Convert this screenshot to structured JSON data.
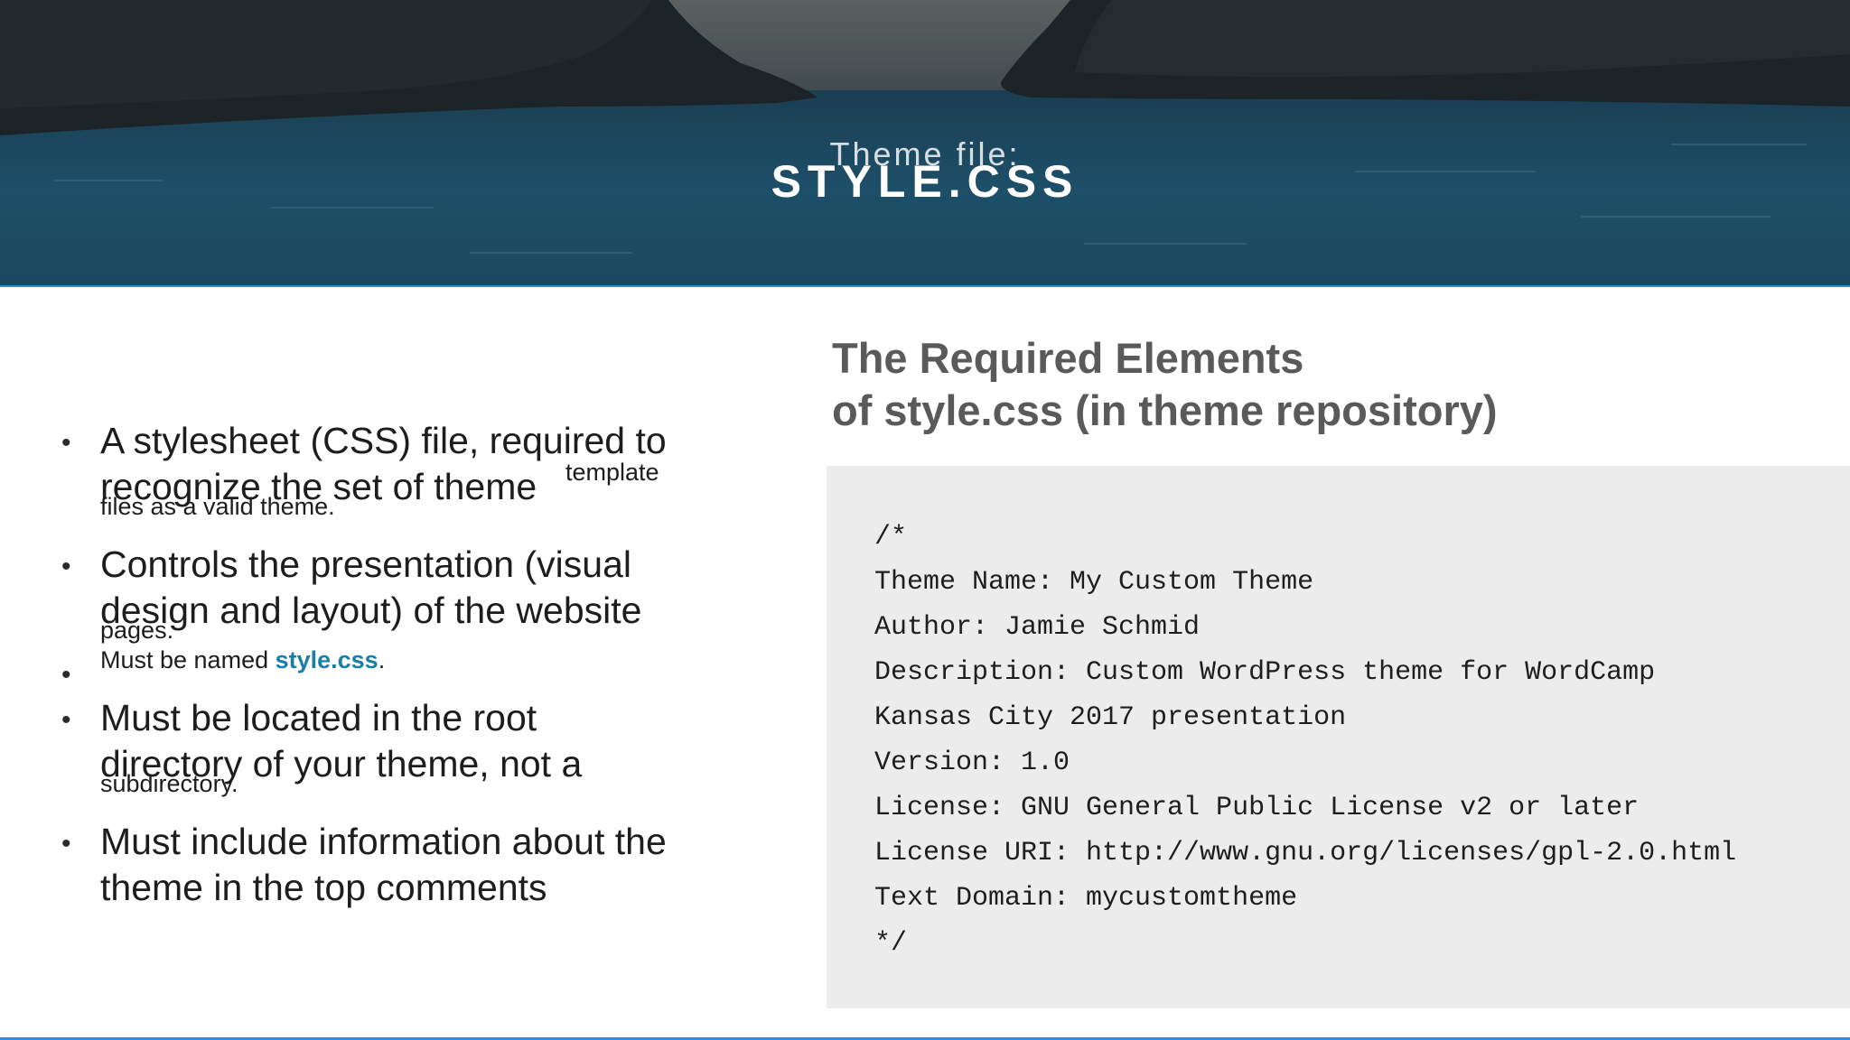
{
  "header": {
    "subtitle": "Theme file:",
    "title": "STYLE.CSS"
  },
  "bullets": {
    "b1_line1": "A stylesheet (CSS) file, required to",
    "b1_line2": "recognize the set of theme",
    "b1_sup": "template",
    "b1_small": "files as a valid theme.",
    "b2_line1": "Controls the presentation (visual",
    "b2_line2": "design and layout) of the website",
    "b2_small": "pages.",
    "b3_prefix": "Must be named ",
    "b3_highlight": "style.css",
    "b3_suffix": ".",
    "b4_line1": "Must be located in the root",
    "b4_line2": "directory of your theme, not a",
    "b4_small": "subdirectory.",
    "b5_line1": "Must include information about the",
    "b5_line2": "theme in the top comments",
    "bullet_glyph": "•"
  },
  "panel": {
    "title_line1": "The Required Elements",
    "title_line2": "of style.css (in theme repository)",
    "code_lines": [
      "/*",
      "Theme Name: My Custom Theme",
      "Author: Jamie Schmid",
      "Description: Custom WordPress theme for WordCamp",
      "Kansas City 2017 presentation",
      "Version: 1.0",
      "License: GNU General Public License v2 or later",
      "License URI: http://www.gnu.org/licenses/gpl-2.0.html",
      "Text Domain: mycustomtheme",
      "*/"
    ]
  },
  "colors": {
    "accent": "#2d8fd0",
    "highlight": "#1a7fa8",
    "panel_bg": "#ececec",
    "heading_gray": "#5a5a5a"
  }
}
